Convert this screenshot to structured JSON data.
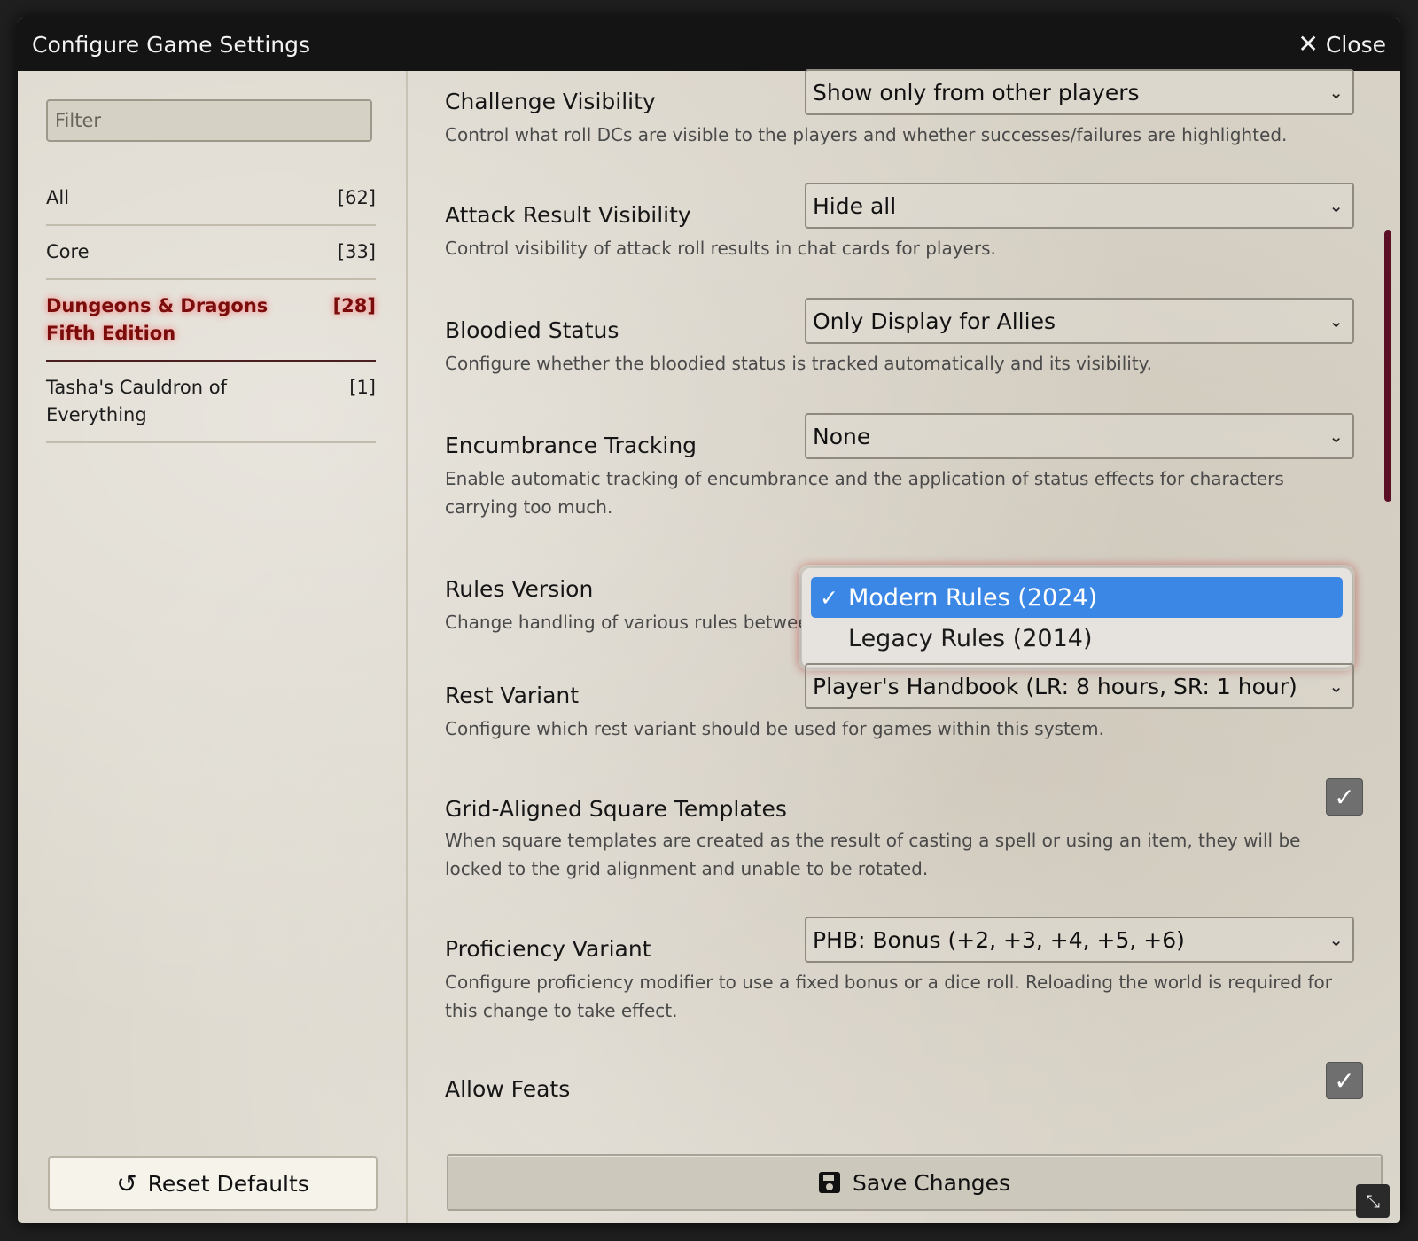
{
  "window": {
    "title": "Configure Game Settings",
    "close_label": "Close"
  },
  "sidebar": {
    "filter_placeholder": "Filter",
    "categories": [
      {
        "label": "All",
        "count": "[62]"
      },
      {
        "label": "Core",
        "count": "[33]"
      },
      {
        "label": "Dungeons & Dragons Fifth Edition",
        "count": "[28]"
      },
      {
        "label": "Tasha's Cauldron of Everything",
        "count": "[1]"
      }
    ],
    "reset_label": "Reset Defaults"
  },
  "settings": [
    {
      "name": "Challenge Visibility",
      "value": "Show only from other players",
      "hint": "Control what roll DCs are visible to the players and whether successes/failures are highlighted."
    },
    {
      "name": "Attack Result Visibility",
      "value": "Hide all",
      "hint": "Control visibility of attack roll results in chat cards for players."
    },
    {
      "name": "Bloodied Status",
      "value": "Only Display for Allies",
      "hint": "Configure whether the bloodied status is tracked automatically and its visibility."
    },
    {
      "name": "Encumbrance Tracking",
      "value": "None",
      "hint": "Enable automatic tracking of encumbrance and the application of status effects for characters carrying too much."
    },
    {
      "name": "Rules Version",
      "hint": "Change handling of various rules betwee"
    },
    {
      "name": "Rest Variant",
      "value": "Player's Handbook (LR: 8 hours, SR: 1 hour)",
      "hint": "Configure which rest variant should be used for games within this system."
    },
    {
      "name": "Grid-Aligned Square Templates",
      "checked": true,
      "hint": "When square templates are created as the result of casting a spell or using an item, they will be locked to the grid alignment and unable to be rotated."
    },
    {
      "name": "Proficiency Variant",
      "value": "PHB: Bonus (+2, +3, +4, +5, +6)",
      "hint": "Configure proficiency modifier to use a fixed bonus or a dice roll. Reloading the world is required for this change to take effect."
    },
    {
      "name": "Allow Feats",
      "checked": true
    }
  ],
  "rules_dropdown": {
    "options": [
      {
        "label": "Modern Rules (2024)",
        "selected": true
      },
      {
        "label": "Legacy Rules (2014)",
        "selected": false
      }
    ]
  },
  "save_label": "Save Changes",
  "icons": {
    "close": "close-icon",
    "reset": "undo-icon",
    "save": "floppy-disk-icon",
    "chevron": "chevron-down-icon",
    "check": "checkmark-icon",
    "resize": "resize-icon"
  },
  "colors": {
    "titlebar": "#141414",
    "active_category": "#7a0c0c",
    "dropdown_selected": "#3a87e6",
    "scrollbar": "#5a0f24"
  }
}
